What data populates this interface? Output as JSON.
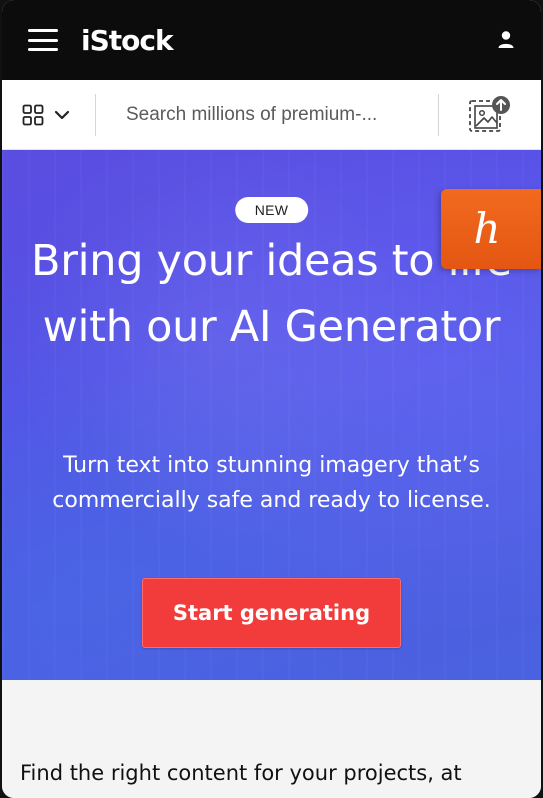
{
  "header": {
    "logo": "iStock",
    "menu_icon": "hamburger-menu-icon",
    "account_icon": "user-icon"
  },
  "search": {
    "asset_type_icon": "grid-icon",
    "placeholder": "Search millions of premium-...",
    "visual_search_icon": "image-upload-icon"
  },
  "hero": {
    "badge": "NEW",
    "title": "Bring your ideas to life with our AI Generator",
    "subtitle": "Turn text into stunning imagery that’s commercially safe and ready to license.",
    "cta_label": "Start generating",
    "colors": {
      "background": "#5652e4",
      "cta": "#f23c3c"
    }
  },
  "extension": {
    "glyph": "h",
    "icon": "honey-extension-icon",
    "color": "#ee6419"
  },
  "lower": {
    "text": "Find the right content for your projects, at"
  }
}
